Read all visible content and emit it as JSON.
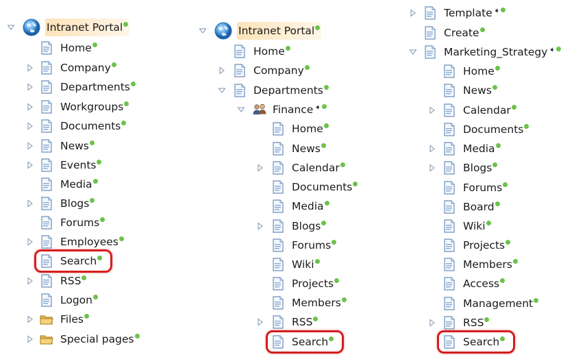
{
  "columns": [
    {
      "items": [
        {
          "label": "Intranet Portal",
          "icon": "globe",
          "arrow": "open",
          "root": true
        },
        {
          "label": "Home",
          "icon": "page"
        },
        {
          "label": "Company",
          "icon": "page",
          "arrow": "closed"
        },
        {
          "label": "Departments",
          "icon": "page",
          "arrow": "closed"
        },
        {
          "label": "Workgroups",
          "icon": "page",
          "arrow": "closed"
        },
        {
          "label": "Documents",
          "icon": "page",
          "arrow": "closed"
        },
        {
          "label": "News",
          "icon": "page",
          "arrow": "closed"
        },
        {
          "label": "Events",
          "icon": "page",
          "arrow": "closed"
        },
        {
          "label": "Media",
          "icon": "page"
        },
        {
          "label": "Blogs",
          "icon": "page",
          "arrow": "closed"
        },
        {
          "label": "Forums",
          "icon": "page"
        },
        {
          "label": "Employees",
          "icon": "page",
          "arrow": "closed"
        },
        {
          "label": "Search",
          "icon": "page",
          "highlight": true
        },
        {
          "label": "RSS",
          "icon": "page",
          "arrow": "closed"
        },
        {
          "label": "Logon",
          "icon": "page"
        },
        {
          "label": "Files",
          "icon": "folder",
          "arrow": "closed"
        },
        {
          "label": "Special pages",
          "icon": "folder",
          "arrow": "closed"
        }
      ]
    },
    {
      "items": [
        {
          "label": "Intranet Portal",
          "icon": "globe",
          "arrow": "open",
          "root": true
        },
        {
          "label": "Home",
          "icon": "page"
        },
        {
          "label": "Company",
          "icon": "page",
          "arrow": "closed"
        },
        {
          "label": "Departments",
          "icon": "page",
          "arrow": "open"
        },
        {
          "label": "Finance",
          "icon": "group",
          "arrow": "open",
          "redirect": true
        },
        {
          "label": "Home",
          "icon": "page"
        },
        {
          "label": "News",
          "icon": "page"
        },
        {
          "label": "Calendar",
          "icon": "page",
          "arrow": "closed"
        },
        {
          "label": "Documents",
          "icon": "page"
        },
        {
          "label": "Media",
          "icon": "page"
        },
        {
          "label": "Blogs",
          "icon": "page",
          "arrow": "closed"
        },
        {
          "label": "Forums",
          "icon": "page"
        },
        {
          "label": "Wiki",
          "icon": "page"
        },
        {
          "label": "Projects",
          "icon": "page"
        },
        {
          "label": "Members",
          "icon": "page"
        },
        {
          "label": "RSS",
          "icon": "page",
          "arrow": "closed"
        },
        {
          "label": "Search",
          "icon": "page",
          "highlight": true
        }
      ]
    },
    {
      "items": [
        {
          "label": "Template",
          "icon": "page",
          "arrow": "closed",
          "redirect": true
        },
        {
          "label": "Create",
          "icon": "page"
        },
        {
          "label": "Marketing_Strategy",
          "icon": "page",
          "arrow": "open",
          "redirect": true
        },
        {
          "label": "Home",
          "icon": "page"
        },
        {
          "label": "News",
          "icon": "page"
        },
        {
          "label": "Calendar",
          "icon": "page",
          "arrow": "closed"
        },
        {
          "label": "Documents",
          "icon": "page"
        },
        {
          "label": "Media",
          "icon": "page",
          "arrow": "closed"
        },
        {
          "label": "Blogs",
          "icon": "page",
          "arrow": "closed"
        },
        {
          "label": "Forums",
          "icon": "page"
        },
        {
          "label": "Board",
          "icon": "page"
        },
        {
          "label": "Wiki",
          "icon": "page"
        },
        {
          "label": "Projects",
          "icon": "page"
        },
        {
          "label": "Members",
          "icon": "page"
        },
        {
          "label": "Access",
          "icon": "page"
        },
        {
          "label": "Management",
          "icon": "page"
        },
        {
          "label": "RSS",
          "icon": "page",
          "arrow": "closed"
        },
        {
          "label": "Search",
          "icon": "page",
          "highlight": true
        }
      ]
    }
  ],
  "colors": {
    "status_dot": "#6cc24a",
    "highlight_ring": "#d41e1e",
    "root_highlight": "#fde3b9"
  }
}
